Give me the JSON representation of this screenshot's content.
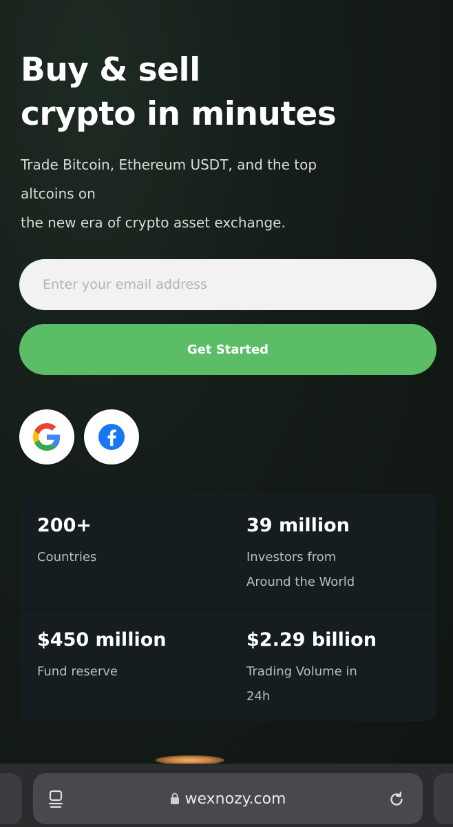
{
  "hero": {
    "title_line1": "Buy & sell",
    "title_line2": "crypto in minutes",
    "subtitle_line1": "Trade Bitcoin, Ethereum USDT, and the top",
    "subtitle_line2": "altcoins on",
    "subtitle_line3": "the new era of crypto asset exchange."
  },
  "signup": {
    "email_placeholder": "Enter your email address",
    "email_value": "",
    "cta_label": "Get Started"
  },
  "social": {
    "google_icon": "google-icon",
    "facebook_icon": "facebook-icon"
  },
  "stats": [
    {
      "value": "200+",
      "label_line1": "Countries",
      "label_line2": ""
    },
    {
      "value": "39 million",
      "label_line1": "Investors from",
      "label_line2": "Around the World"
    },
    {
      "value": "$450 million",
      "label_line1": "Fund reserve",
      "label_line2": ""
    },
    {
      "value": "$2.29 billion",
      "label_line1": "Trading Volume in",
      "label_line2": "24h"
    }
  ],
  "browser": {
    "url": "wexnozy.com",
    "lock_icon": "lock-icon",
    "tabs_icon": "tab-overview-icon",
    "reload_icon": "reload-icon"
  },
  "colors": {
    "background": "#141c18",
    "accent_green": "#5cbd67",
    "card": "#161d21",
    "input_bg": "#f2f2f2",
    "facebook_blue": "#1877f2"
  }
}
